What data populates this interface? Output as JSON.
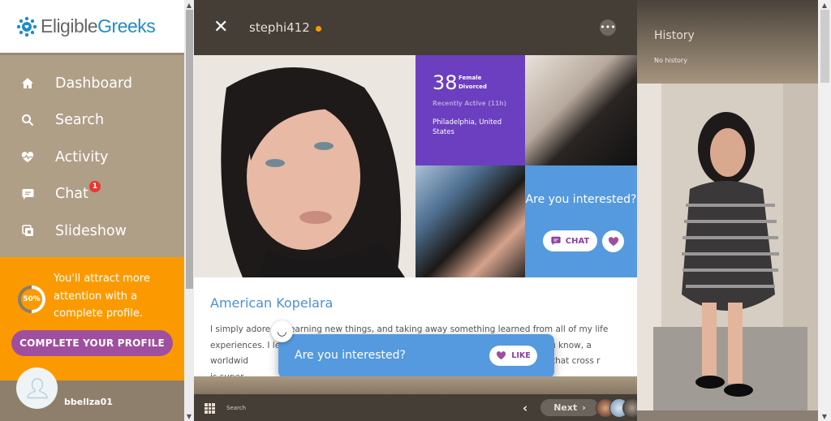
{
  "brand": {
    "name_part1": "Eligible",
    "name_part2": "Greeks",
    "accent": "#1f8cc6"
  },
  "sidebar": {
    "items": [
      {
        "label": "Dashboard",
        "icon": "home-icon"
      },
      {
        "label": "Search",
        "icon": "search-icon"
      },
      {
        "label": "Activity",
        "icon": "heartbeat-icon"
      },
      {
        "label": "Chat",
        "icon": "chat-icon",
        "badge": "1"
      },
      {
        "label": "Slideshow",
        "icon": "slideshow-icon"
      }
    ],
    "promo": {
      "progress_label": "50%",
      "progress": 0.5,
      "text": "You'll attract more attention with a complete profile.",
      "button": "COMPLETE YOUR PROFILE"
    },
    "user": {
      "username": "bbellza01"
    }
  },
  "profile": {
    "username": "stephi412",
    "online_status_color": "#fb9a00",
    "age": "38",
    "gender": "Female",
    "marital_status": "Divorced",
    "recent_activity": "Recently Active (11h)",
    "location": "Philadelphia, United States",
    "interest_prompt": "Are you interested?",
    "chat_label": "CHAT",
    "bio_title": "American Kopelara",
    "bio_text": "I simply adore t    learning new things, and taking away something learned from all of my life experiences. I let                                                                                  visit, or you know, a worldwid                                                                               t I can offer to those that cross r                                                                              is super"
  },
  "interest_bar": {
    "text": "Are you interested?",
    "like_label": "LIKE"
  },
  "footer": {
    "search_label": "Search",
    "next_label": "Next"
  },
  "history": {
    "title": "History",
    "empty_text": "No history"
  }
}
